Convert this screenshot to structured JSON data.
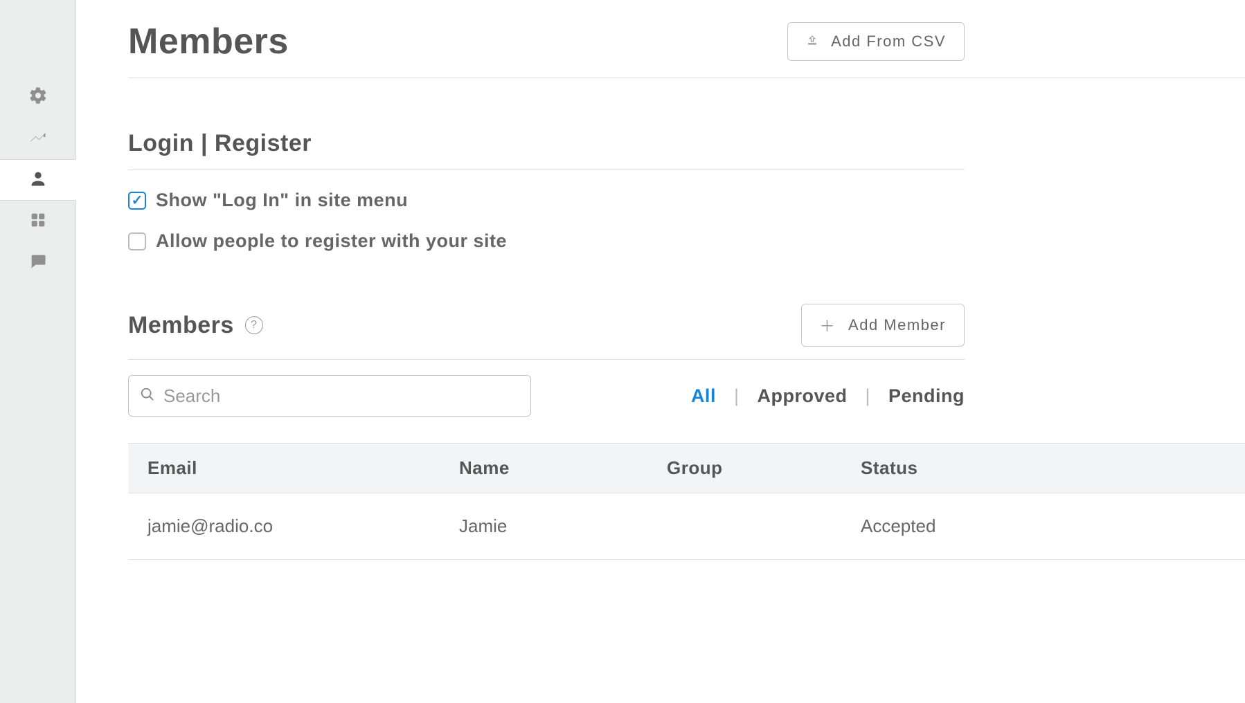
{
  "page": {
    "title": "Members"
  },
  "buttons": {
    "add_from_csv": "Add From CSV",
    "add_member": "Add Member"
  },
  "login_section": {
    "title": "Login | Register",
    "show_login_label": "Show \"Log In\" in site menu",
    "show_login_checked": true,
    "allow_register_label": "Allow people to register with your site",
    "allow_register_checked": false
  },
  "members_section": {
    "title": "Members"
  },
  "search": {
    "placeholder": "Search",
    "value": ""
  },
  "filters": {
    "all": "All",
    "approved": "Approved",
    "pending": "Pending",
    "active": "all"
  },
  "table": {
    "headers": {
      "email": "Email",
      "name": "Name",
      "group": "Group",
      "status": "Status"
    },
    "rows": [
      {
        "email": "jamie@radio.co",
        "name": "Jamie",
        "group": "",
        "status": "Accepted"
      }
    ]
  },
  "sidebar": {
    "items": [
      {
        "name": "settings",
        "icon": "gear-icon"
      },
      {
        "name": "analytics",
        "icon": "trend-icon"
      },
      {
        "name": "members",
        "icon": "person-icon",
        "active": true
      },
      {
        "name": "apps",
        "icon": "grid-icon"
      },
      {
        "name": "comments",
        "icon": "chat-icon"
      }
    ]
  }
}
